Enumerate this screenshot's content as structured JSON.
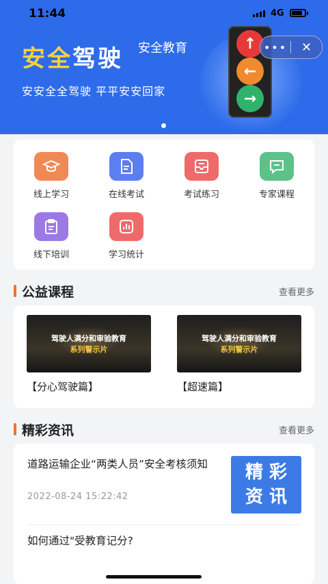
{
  "status": {
    "time": "11:44",
    "network": "4G"
  },
  "banner": {
    "title_part1": "安全",
    "title_part2": "驾驶",
    "subtitle": "安全教育",
    "slogan": "安安全全驾驶  平平安安回家"
  },
  "capsule": {
    "more": "•••",
    "close": "✕"
  },
  "menu": [
    {
      "label": "线上学习",
      "icon": "graduation-cap-icon",
      "color": "#f08a55"
    },
    {
      "label": "在线考试",
      "icon": "document-icon",
      "color": "#5d7ef0"
    },
    {
      "label": "考试练习",
      "icon": "inbox-icon",
      "color": "#ef6a6a"
    },
    {
      "label": "专家课程",
      "icon": "chat-icon",
      "color": "#5cc28a"
    },
    {
      "label": "线下培训",
      "icon": "clipboard-icon",
      "color": "#9b7ae6"
    },
    {
      "label": "学习统计",
      "icon": "stats-icon",
      "color": "#ef6a6a"
    }
  ],
  "courses_section": {
    "title": "公益课程",
    "more": "查看更多"
  },
  "courses": [
    {
      "thumb_line1": "驾驶人满分和审验教育",
      "thumb_line2": "系列警示片",
      "caption": "【分心驾驶篇】"
    },
    {
      "thumb_line1": "驾驶人满分和审验教育",
      "thumb_line2": "系列警示片",
      "caption": "【超速篇】"
    }
  ],
  "news_section": {
    "title": "精彩资讯",
    "more": "查看更多"
  },
  "news": [
    {
      "title": "道路运输企业“两类人员”安全考核须知",
      "date": "2022-08-24 15:22:42",
      "badge_line1": "精 彩",
      "badge_line2": "资 讯"
    },
    {
      "title": "如何通过\"受教育记分?"
    }
  ]
}
